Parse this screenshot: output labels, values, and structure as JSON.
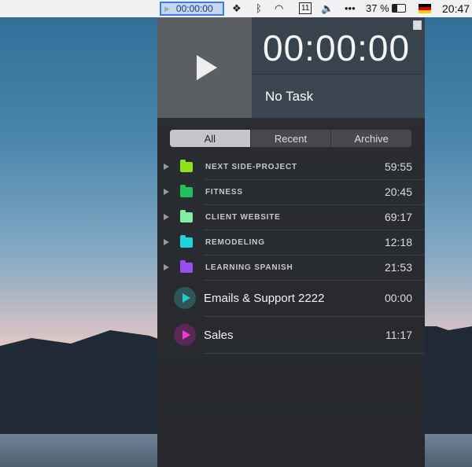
{
  "menubar": {
    "timer": "00:00:00",
    "battery": "37 %",
    "clock": "20:47",
    "calendar_day": "11"
  },
  "header": {
    "timer": "00:00:00",
    "task": "No Task"
  },
  "tabs": [
    {
      "label": "All"
    },
    {
      "label": "Recent"
    },
    {
      "label": "Archive"
    }
  ],
  "projects": [
    {
      "name": "NEXT SIDE-PROJECT",
      "time": "59:55",
      "color": "#8fe31a"
    },
    {
      "name": "FITNESS",
      "time": "20:45",
      "color": "#1fc25a"
    },
    {
      "name": "CLIENT WEBSITE",
      "time": "69:17",
      "color": "#7ef0a2"
    },
    {
      "name": "REMODELING",
      "time": "12:18",
      "color": "#1fd3db"
    },
    {
      "name": "LEARNING SPANISH",
      "time": "21:53",
      "color": "#9b4ef0"
    }
  ],
  "tasks": [
    {
      "name": "Emails & Support 2222",
      "time": "00:00",
      "color": "#27c6d0",
      "bg": "#2e5559"
    },
    {
      "name": "Sales",
      "time": "11:17",
      "color": "#f03ad0",
      "bg": "#5a2756"
    }
  ]
}
